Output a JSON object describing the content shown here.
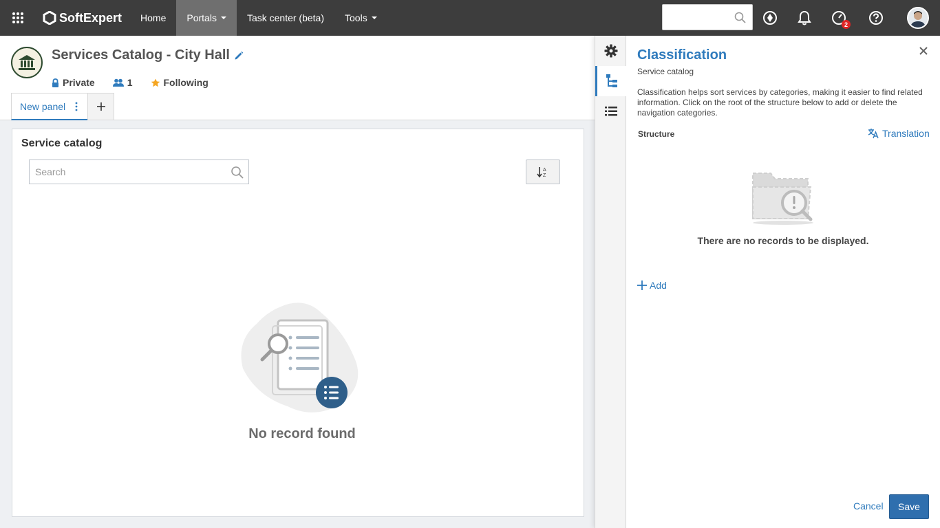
{
  "topbar": {
    "brand": "SoftExpert",
    "nav": [
      {
        "label": "Home"
      },
      {
        "label": "Portals"
      },
      {
        "label": "Task center (beta)"
      },
      {
        "label": "Tools"
      }
    ],
    "search_placeholder": "",
    "notification_badge": "2"
  },
  "portal": {
    "title": "Services Catalog - City Hall",
    "privacy": "Private",
    "members": "1",
    "following": "Following"
  },
  "tabs": {
    "items": [
      {
        "label": "New panel"
      }
    ],
    "add_label": "+"
  },
  "widget": {
    "title": "Service catalog",
    "search_placeholder": "Search",
    "empty_message": "No record found"
  },
  "panel": {
    "title": "Classification",
    "subtitle": "Service catalog",
    "description": "Classification helps sort services by categories, making it easier to find related information. Click on the root of the structure below to add or delete the navigation categories.",
    "structure_label": "Structure",
    "translation_label": "Translation",
    "empty_message": "There are no records to be displayed.",
    "add_label": "Add",
    "cancel_label": "Cancel",
    "save_label": "Save"
  },
  "colors": {
    "topbar": "#3d3d3d",
    "accent": "#2f7bbd",
    "primary_button": "#2f6fae",
    "badge": "#e02424"
  }
}
